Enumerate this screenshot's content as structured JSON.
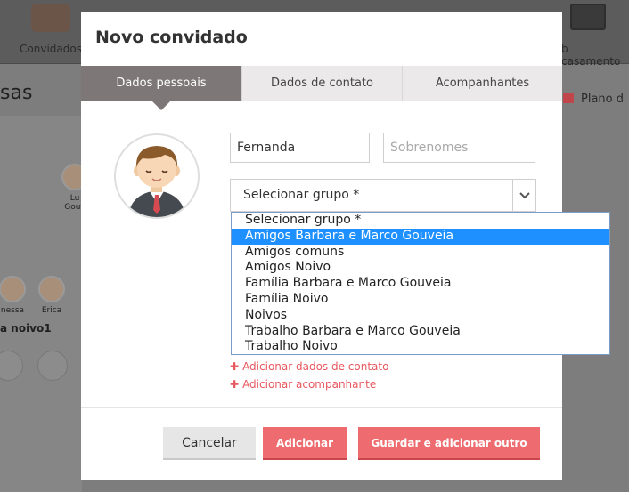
{
  "background": {
    "nav_left_label": "Convidados",
    "nav_right_label": "b casamento",
    "heading": "sas",
    "plan_label": "Plano d",
    "guests": [
      {
        "name": "Lu",
        "name2": "Gouv"
      },
      {
        "name": "nessa"
      },
      {
        "name": "Erica"
      }
    ],
    "table_name": "a noivo1"
  },
  "modal": {
    "title": "Novo convidado",
    "tabs": [
      {
        "label": "Dados pessoais",
        "active": true
      },
      {
        "label": "Dados de contato",
        "active": false
      },
      {
        "label": "Acompanhantes",
        "active": false
      }
    ],
    "first_name_value": "Fernanda",
    "last_name_placeholder": "Sobrenomes",
    "group_select": {
      "selected": "Selecionar grupo *",
      "options": [
        "Selecionar grupo *",
        "Amigos Barbara e Marco Gouveia",
        "Amigos comuns",
        "Amigos Noivo",
        "Família Barbara e Marco Gouveia",
        "Família Noivo",
        "Noivos",
        "Trabalho Barbara e Marco Gouveia",
        "Trabalho Noivo"
      ],
      "highlighted_index": 1
    },
    "links": {
      "add_contact": "Adicionar dados de contato",
      "add_companion": "Adicionar acompanhante"
    },
    "footer": {
      "cancel_label": "Cancelar",
      "add_label": "Adicionar",
      "save_add_label": "Guardar e adicionar outro"
    }
  },
  "colors": {
    "accent": "#ee6b6f",
    "tab_active": "#7d7777",
    "highlight": "#1e90ff"
  }
}
